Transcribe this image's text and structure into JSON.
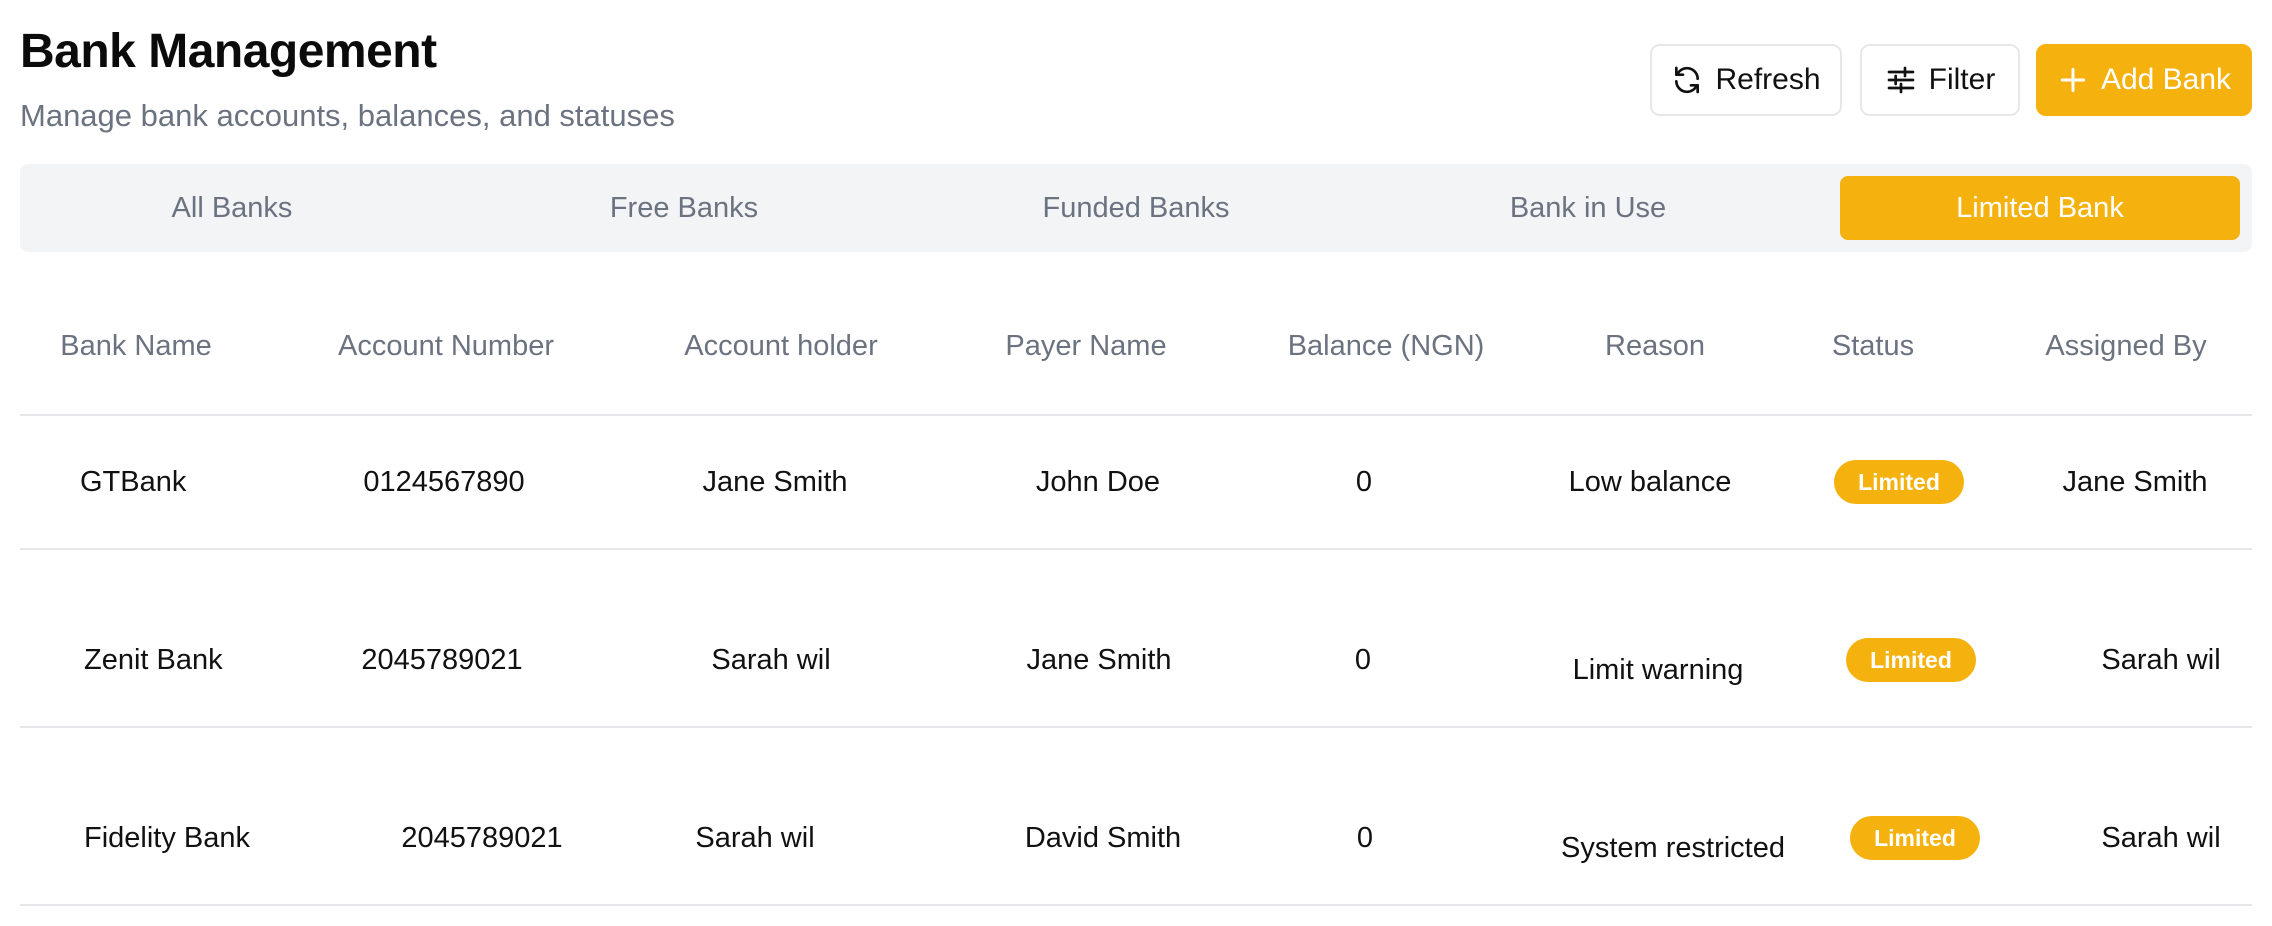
{
  "header": {
    "title": "Bank Management",
    "subtitle": "Manage bank accounts, balances, and statuses"
  },
  "toolbar": {
    "refresh_label": "Refresh",
    "filter_label": "Filter",
    "add_label": "Add Bank"
  },
  "tabs": [
    {
      "label": "All Banks",
      "active": false
    },
    {
      "label": "Free Banks",
      "active": false
    },
    {
      "label": "Funded Banks",
      "active": false
    },
    {
      "label": "Bank in Use",
      "active": false
    },
    {
      "label": "Limited Bank",
      "active": true
    }
  ],
  "table": {
    "columns": [
      "Bank Name",
      "Account Number",
      "Account holder",
      "Payer Name",
      "Balance (NGN)",
      "Reason",
      "Status",
      "Assigned  By"
    ],
    "rows": [
      {
        "bank": "GTBank",
        "account": "0124567890",
        "holder": "Jane Smith",
        "payer": "John Doe",
        "balance": "0",
        "reason": "Low balance",
        "status": "Limited",
        "assigned": "Jane Smith"
      },
      {
        "bank": "Zenit Bank",
        "account": "2045789021",
        "holder": "Sarah wil",
        "payer": "Jane Smith",
        "balance": "0",
        "reason": "Limit warning",
        "status": "Limited",
        "assigned": "Sarah wil"
      },
      {
        "bank": "Fidelity Bank",
        "account": "2045789021",
        "holder": "Sarah wil",
        "payer": "David Smith",
        "balance": "0",
        "reason": "System restricted",
        "status": "Limited",
        "assigned": "Sarah wil"
      }
    ]
  },
  "colors": {
    "accent": "#f5b20f",
    "muted_text": "#6b7280",
    "tab_bar_bg": "#f3f4f6",
    "border": "#e5e7eb"
  },
  "icons": {
    "refresh": "refresh-icon",
    "filter": "sliders-icon",
    "add": "plus-icon"
  }
}
